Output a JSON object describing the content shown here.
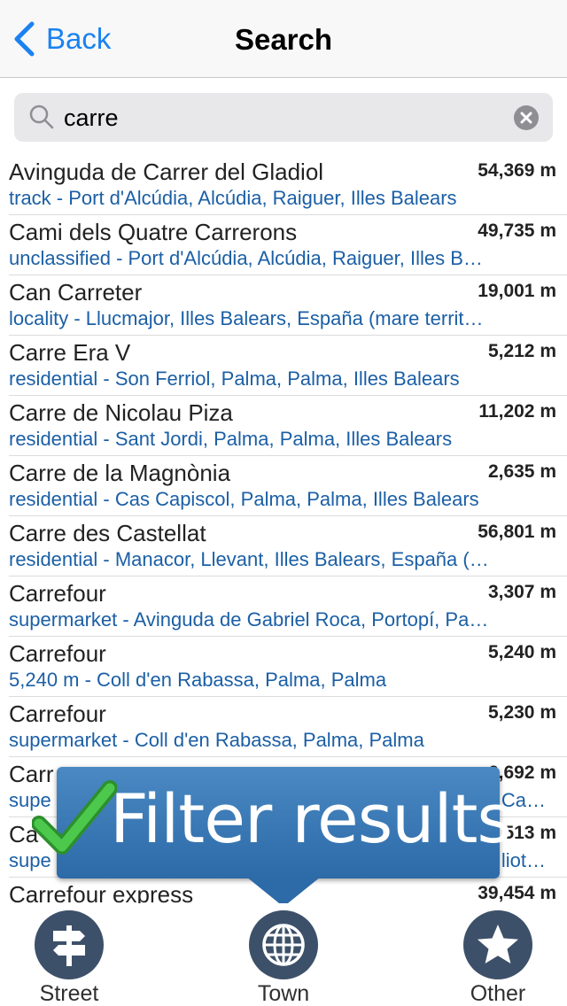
{
  "navbar": {
    "back_label": "Back",
    "title": "Search"
  },
  "search": {
    "value": "carre",
    "placeholder": ""
  },
  "results": [
    {
      "name": "Avinguda de Carrer del Gladiol",
      "distance": "54,369 m",
      "detail": "track - Port d'Alcúdia, Alcúdia, Raiguer, Illes Balears"
    },
    {
      "name": "Cami dels Quatre Carrerons",
      "distance": "49,735 m",
      "detail": "unclassified - Port d'Alcúdia, Alcúdia, Raiguer, Illes B…"
    },
    {
      "name": "Can Carreter",
      "distance": "19,001 m",
      "detail": "locality - Llucmajor, Illes Balears, España (mare territ…"
    },
    {
      "name": "Carre Era V",
      "distance": "5,212 m",
      "detail": "residential - Son Ferriol, Palma, Palma, Illes Balears"
    },
    {
      "name": "Carre de Nicolau Piza",
      "distance": "11,202 m",
      "detail": "residential - Sant Jordi, Palma, Palma, Illes Balears"
    },
    {
      "name": "Carre de la Magnònia",
      "distance": "2,635 m",
      "detail": "residential - Cas Capiscol, Palma, Palma, Illes Balears"
    },
    {
      "name": "Carre des Castellat",
      "distance": "56,801 m",
      "detail": "residential - Manacor, Llevant, Illes Balears, España (…"
    },
    {
      "name": "Carrefour",
      "distance": "3,307 m",
      "detail": "supermarket - Avinguda de Gabriel Roca, Portopí, Pa…"
    },
    {
      "name": "Carrefour",
      "distance": "5,240 m",
      "detail": "5,240 m - Coll d'en Rabassa, Palma, Palma"
    },
    {
      "name": "Carrefour",
      "distance": "5,230 m",
      "detail": "supermarket - Coll d'en Rabassa, Palma, Palma"
    },
    {
      "name": "Carr",
      "distance": "6,692 m",
      "detail": "supe",
      "detail_tail": "Ca…"
    },
    {
      "name": "Ca",
      "distance": "513 m",
      "detail": "supe",
      "detail_tail": "liot…"
    },
    {
      "name": "Carrefour express",
      "distance": "39,454 m",
      "detail": ""
    }
  ],
  "banner": {
    "text": "Filter results"
  },
  "toolbar": {
    "street_label": "Street",
    "town_label": "Town",
    "other_label": "Other"
  },
  "colors": {
    "accent": "#1a82f0",
    "detail_text": "#1b5fa5",
    "toolbar_circle": "#3d5069",
    "banner": "#2c6aa8",
    "check": "#3cb83c"
  }
}
